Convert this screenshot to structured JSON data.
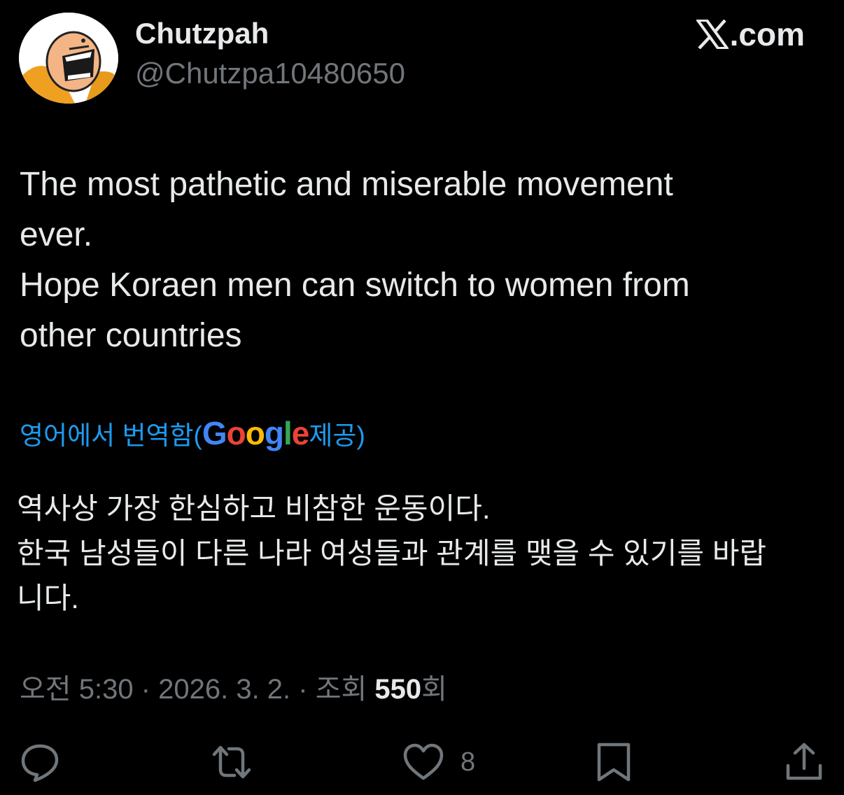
{
  "header": {
    "display_name": "Chutzpah",
    "handle": "@Chutzpa10480650",
    "brand_domain": ".com",
    "avatar_icon": "cartoon-face-avatar",
    "brand_icon": "x-logo-icon"
  },
  "tweet": {
    "lines": [
      "The most pathetic and miserable movement",
      "ever.",
      "Hope Koraen men can switch to women from",
      "other countries"
    ]
  },
  "translation": {
    "label_prefix": "영어에서 번역함(",
    "google_letters": [
      "G",
      "o",
      "o",
      "g",
      "l",
      "e"
    ],
    "label_suffix": " 제공)",
    "lines": [
      "역사상 가장 한심하고 비참한 운동이다.",
      "한국 남성들이 다른 나라 여성들과 관계를 맺을 수 있기를 바랍",
      "니다."
    ]
  },
  "meta": {
    "time_date": "오전 5:30 · 2026. 3. 2. · 조회 ",
    "views": "550",
    "views_suffix": "회"
  },
  "actions": {
    "reply_icon": "reply-icon",
    "retweet_icon": "retweet-icon",
    "like_icon": "heart-icon",
    "like_count": "8",
    "bookmark_icon": "bookmark-icon",
    "share_icon": "share-icon"
  },
  "colors": {
    "background": "#000000",
    "text": "#e7e9ea",
    "muted": "#71767b",
    "link": "#1d9bf0"
  }
}
